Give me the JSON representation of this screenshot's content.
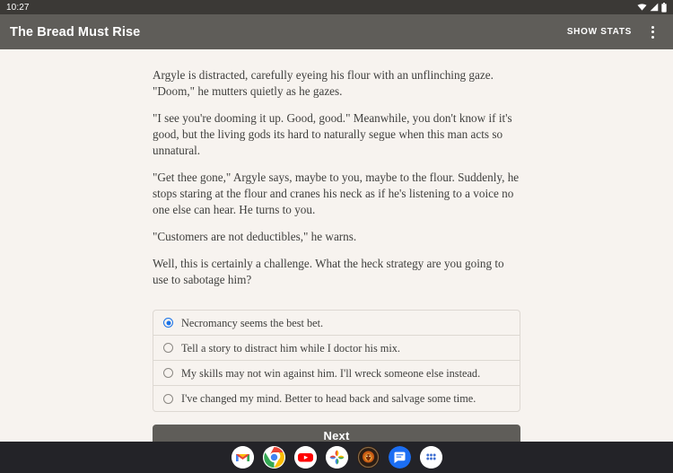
{
  "status_bar": {
    "time": "10:27",
    "icons": [
      "wifi-icon",
      "signal-icon",
      "battery-icon"
    ]
  },
  "app_bar": {
    "title": "The Bread Must Rise",
    "show_stats_label": "SHOW STATS",
    "overflow_icon": "overflow-menu-icon",
    "background_color": "#5f5d59"
  },
  "story": {
    "paragraphs": [
      "Argyle is distracted, carefully eyeing his flour with an unflinching gaze. \"Doom,\" he mutters quietly as he gazes.",
      "\"I see you're dooming it up. Good, good.\" Meanwhile, you don't know if it's good, but the living gods its hard to naturally segue when this man acts so unnatural.",
      "\"Get thee gone,\" Argyle says, maybe to you, maybe to the flour. Suddenly, he stops staring at the flour and cranes his neck as if he's listening to a voice no one else can hear. He turns to you.",
      "\"Customers are not deductibles,\" he warns.",
      "Well, this is certainly a challenge. What the heck strategy are you going to use to sabotage him?"
    ]
  },
  "choices": {
    "selected_index": 0,
    "accent_color": "#1a73e8",
    "options": [
      {
        "label": "Necromancy seems the best bet.",
        "selected": true
      },
      {
        "label": "Tell a story to distract him while I doctor his mix.",
        "selected": false
      },
      {
        "label": "My skills may not win against him. I'll wreck someone else instead.",
        "selected": false
      },
      {
        "label": "I've changed my mind. Better to head back and salvage some time.",
        "selected": false
      }
    ]
  },
  "next_button": {
    "label": "Next"
  },
  "dock": {
    "background_color": "#232328",
    "items": [
      {
        "name": "gmail-icon",
        "label": "Gmail"
      },
      {
        "name": "chrome-icon",
        "label": "Chrome"
      },
      {
        "name": "youtube-icon",
        "label": "YouTube"
      },
      {
        "name": "google-photos-icon",
        "label": "Photos"
      },
      {
        "name": "lion-game-icon",
        "label": "Game"
      },
      {
        "name": "messages-icon",
        "label": "Messages"
      },
      {
        "name": "app-drawer-icon",
        "label": "All apps"
      }
    ]
  }
}
